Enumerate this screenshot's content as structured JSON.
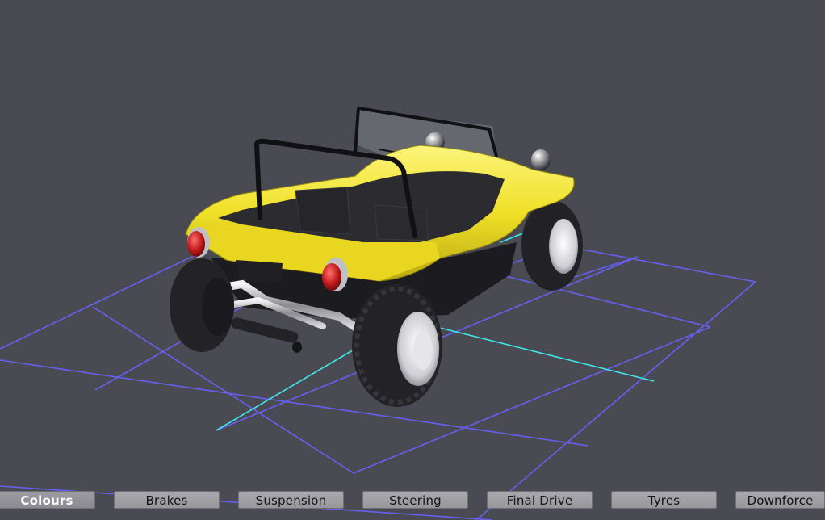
{
  "tabs": [
    {
      "label": "Colours",
      "active": true
    },
    {
      "label": "Brakes",
      "active": false
    },
    {
      "label": "Suspension",
      "active": false
    },
    {
      "label": "Steering",
      "active": false
    },
    {
      "label": "Final Drive",
      "active": false
    },
    {
      "label": "Tyres",
      "active": false
    },
    {
      "label": "Downforce",
      "active": false
    }
  ],
  "colors": {
    "background": "#4a4a52",
    "grid_line": "#6660f0",
    "grid_axis": "#40e6e6",
    "body_paint": "#f2e628",
    "tab_face": "#a0a0a5"
  }
}
